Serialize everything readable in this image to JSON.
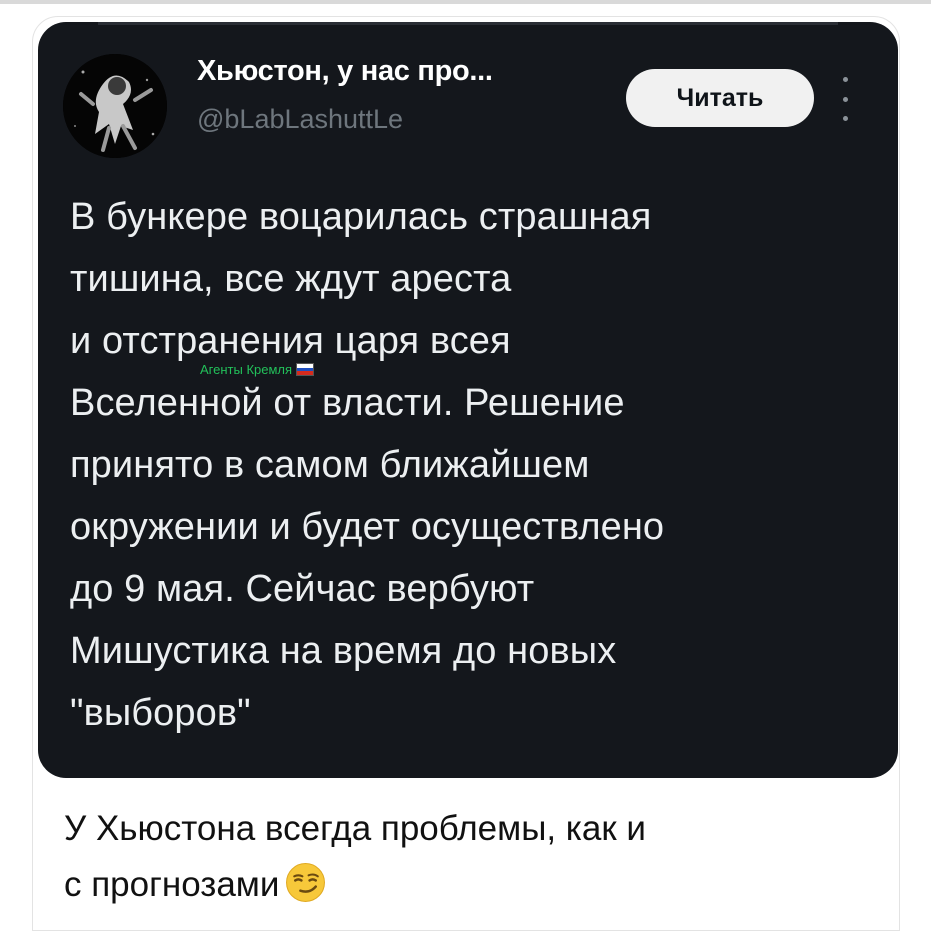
{
  "tweet": {
    "author_name": "Хьюстон, у нас про...",
    "handle": "@bLabLashuttLe",
    "follow_button_label": "Читать",
    "text": "В бункере воцарилась страшная\nтишина, все ждут ареста\nи отстранения царя всея\nВселенной от власти. Решение\nпринято в самом ближайшем\nокружении и будет  осуществлено\nдо 9 мая. Сейчас вербуют\nМишустика на время до новых\n\"выборов\"",
    "watermark": "Агенты Кремля",
    "avatar_icon": "astronaut-avatar",
    "more_icon": "vertical-dots-icon"
  },
  "caption": {
    "text": "У Хьюстона всегда проблемы, как и\nс прогнозами",
    "emoji": "smirking-face-emoji"
  },
  "colors": {
    "tweet_background": "#14171c",
    "tweet_text": "#eceff1",
    "handle": "#6e767d",
    "watermark": "#22c05a",
    "button_bg": "#f1f1f1"
  }
}
